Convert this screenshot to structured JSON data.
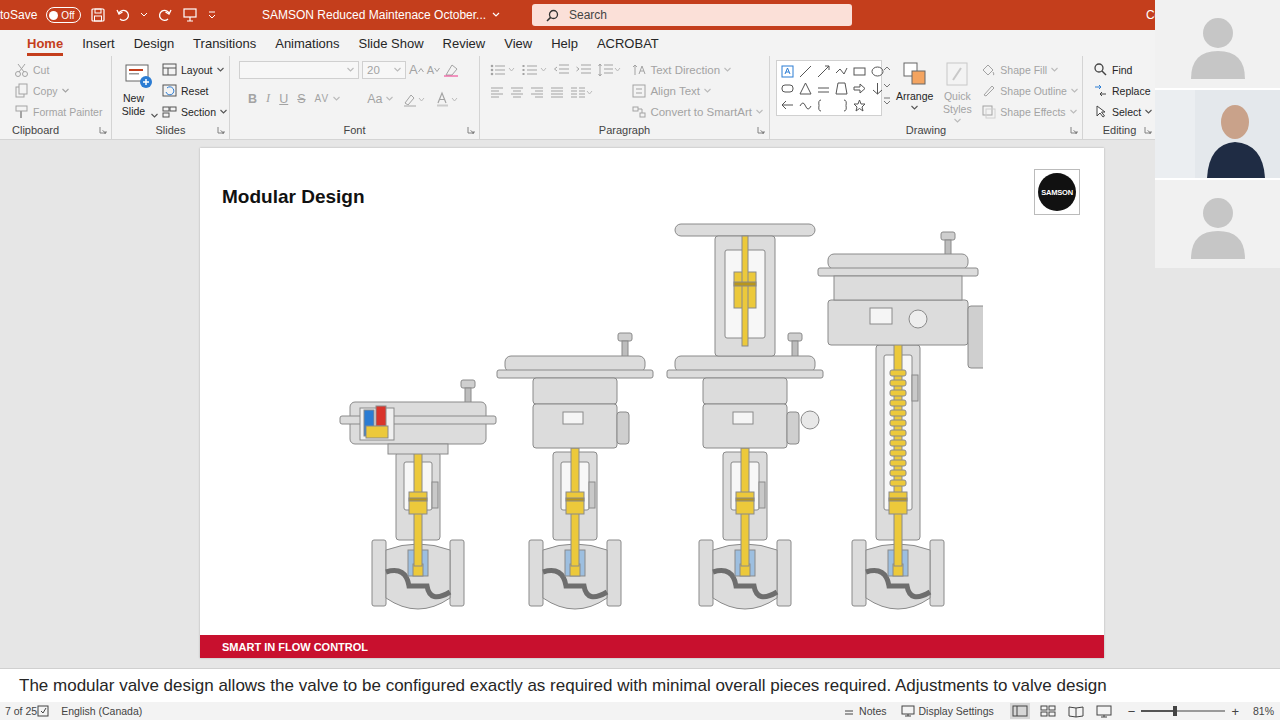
{
  "titlebar": {
    "autosave": {
      "label": "toSave",
      "state": "Off",
      "on": false
    },
    "title": "SAMSON Reduced Maintenace October...",
    "search": {
      "placeholder": "Search"
    },
    "user": "Cousineau, Chris",
    "avatar": "CC"
  },
  "menu_tabs": [
    {
      "label": "Home",
      "selected": true
    },
    {
      "label": "Insert",
      "selected": false
    },
    {
      "label": "Design",
      "selected": false
    },
    {
      "label": "Transitions",
      "selected": false
    },
    {
      "label": "Animations",
      "selected": false
    },
    {
      "label": "Slide Show",
      "selected": false
    },
    {
      "label": "Review",
      "selected": false
    },
    {
      "label": "View",
      "selected": false
    },
    {
      "label": "Help",
      "selected": false
    },
    {
      "label": "ACROBAT",
      "selected": false
    }
  ],
  "ribbon": {
    "clipboard": {
      "label": "Clipboard",
      "items": [
        {
          "label": "Cut",
          "disabled": true,
          "dropdown": false
        },
        {
          "label": "Copy",
          "disabled": true,
          "dropdown": true
        },
        {
          "label": "Format Painter",
          "disabled": true,
          "dropdown": false
        }
      ]
    },
    "slides": {
      "label": "Slides",
      "new_slide": "New Slide",
      "items": [
        {
          "label": "Layout",
          "dropdown": true
        },
        {
          "label": "Reset",
          "dropdown": false
        },
        {
          "label": "Section",
          "dropdown": true
        }
      ]
    },
    "font": {
      "label": "Font",
      "size": "20",
      "size_tools": [
        "A",
        "A"
      ],
      "format_buttons": [
        "B",
        "I",
        "U",
        "S",
        "AV",
        "Aa"
      ],
      "disabled": true
    },
    "paragraph": {
      "label": "Paragraph",
      "items": [
        {
          "label": "Text Direction",
          "disabled": true
        },
        {
          "label": "Align Text",
          "disabled": true
        },
        {
          "label": "Convert to SmartArt",
          "disabled": true
        }
      ]
    },
    "drawing": {
      "label": "Drawing",
      "arrange": {
        "label": "Arrange",
        "disabled": false
      },
      "quick_styles": {
        "label": "Quick Styles",
        "disabled": true
      },
      "items": [
        {
          "label": "Shape Fill",
          "disabled": true
        },
        {
          "label": "Shape Outline",
          "disabled": true
        },
        {
          "label": "Shape Effects",
          "disabled": true
        }
      ]
    },
    "editing": {
      "label": "Editing",
      "items": [
        {
          "label": "Find",
          "dropdown": false
        },
        {
          "label": "Replace",
          "dropdown": false
        },
        {
          "label": "Select",
          "dropdown": true
        }
      ]
    }
  },
  "slide": {
    "title": "Modular Design",
    "logo": "SAMSON",
    "footer": "SMART IN FLOW CONTROL",
    "valves": [
      {
        "kind": "compact"
      },
      {
        "kind": "standard"
      },
      {
        "kind": "handwheel"
      },
      {
        "kind": "bellows"
      }
    ]
  },
  "notes": "The modular valve design allows the valve to be configured exactly as required with minimal overall pieces required.  Adjustments to valve design",
  "status_bar": {
    "slide": "7 of 25",
    "language": "English (Canada)",
    "notes": "Notes",
    "display_settings": "Display Settings",
    "views": [
      {
        "selected": true
      },
      {
        "selected": false
      },
      {
        "selected": false
      },
      {
        "selected": false
      }
    ],
    "zoom_out": "−",
    "zoom_in": "+",
    "zoom_level": 0.4,
    "zoom": "81%"
  },
  "participants": [
    {
      "kind": "avatar"
    },
    {
      "kind": "video"
    },
    {
      "kind": "avatar"
    }
  ]
}
